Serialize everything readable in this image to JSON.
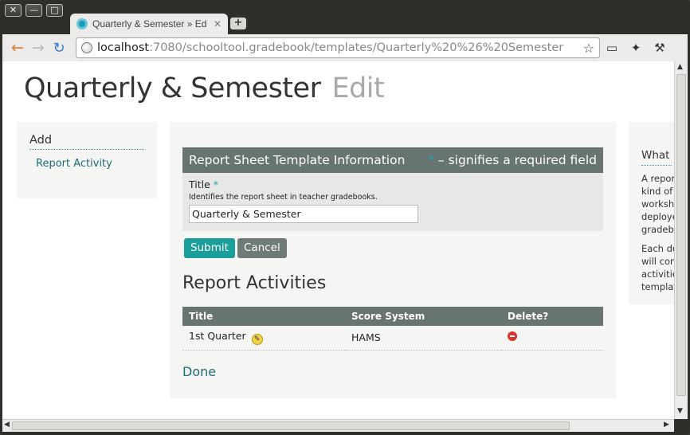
{
  "browser": {
    "window_buttons": [
      "✕",
      "—",
      "□"
    ],
    "tab_title": "Quarterly & Semester » Ed",
    "tab_close": "✕",
    "new_tab": "+",
    "url_host": "localhost",
    "url_rest": ":7080/schooltool.gradebook/templates/Quarterly%20%26%20Semester"
  },
  "page": {
    "title": "Quarterly & Semester",
    "subtitle": "Edit"
  },
  "left_panel": {
    "heading": "Add",
    "link": "Report Activity"
  },
  "form": {
    "header": "Report Sheet Template Information",
    "required_marker": "*",
    "required_note": "– signifies a required field",
    "field_label": "Title",
    "field_hint": "Identifies the report sheet in teacher gradebooks.",
    "field_value": "Quarterly & Semester",
    "submit_label": "Submit",
    "cancel_label": "Cancel"
  },
  "activities": {
    "title": "Report Activities",
    "columns": [
      "Title",
      "Score System",
      "Delete?"
    ],
    "rows": [
      {
        "title": "1st Quarter",
        "score_system": "HAMS"
      }
    ],
    "done_label": "Done"
  },
  "right_panel": {
    "heading": "What i",
    "para1": [
      "A repor",
      "kind of",
      "workshe",
      "deploye",
      "gradebo"
    ],
    "para2": [
      "Each de",
      "will con",
      "activitie",
      "templat"
    ]
  }
}
